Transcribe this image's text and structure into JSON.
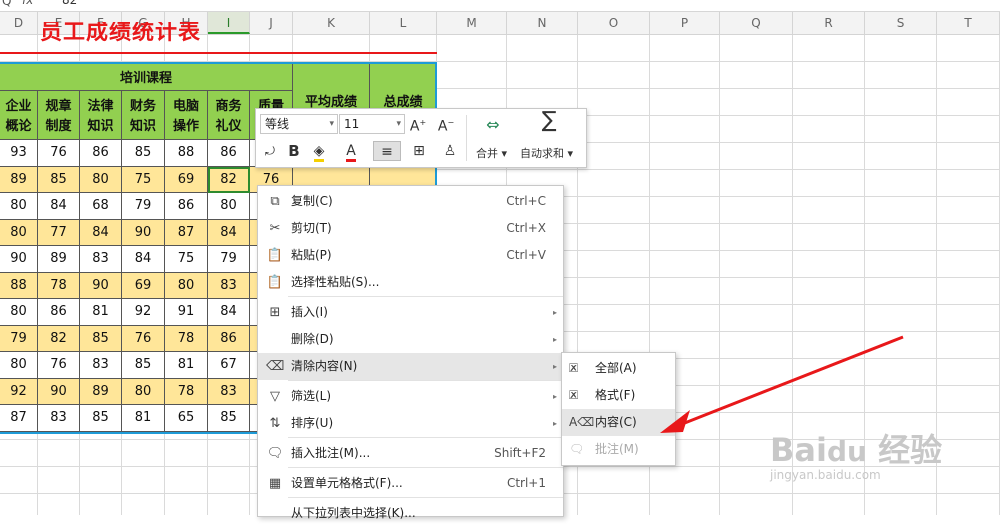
{
  "formula_bar": {
    "search_glyph": "Q",
    "fx_label": "fx",
    "value": "82"
  },
  "columns": [
    "D",
    "E",
    "F",
    "G",
    "H",
    "I",
    "J",
    "K",
    "L",
    "M",
    "N",
    "O",
    "P",
    "Q",
    "R",
    "S",
    "T"
  ],
  "title_fragment": "员工成绩统计表",
  "table": {
    "group_header": "培训课程",
    "avg_header": "平均成绩",
    "total_header": "总成绩",
    "course_headers": [
      "企业\n概论",
      "规章\n制度",
      "法律\n知识",
      "财务\n知识",
      "电脑\n操作",
      "商务\n礼仪",
      "质量"
    ],
    "rows": [
      [
        "93",
        "76",
        "86",
        "85",
        "88",
        "86",
        ""
      ],
      [
        "89",
        "85",
        "80",
        "75",
        "69",
        "82",
        "76"
      ],
      [
        "80",
        "84",
        "68",
        "79",
        "86",
        "80",
        ""
      ],
      [
        "80",
        "77",
        "84",
        "90",
        "87",
        "84",
        ""
      ],
      [
        "90",
        "89",
        "83",
        "84",
        "75",
        "79",
        ""
      ],
      [
        "88",
        "78",
        "90",
        "69",
        "80",
        "83",
        ""
      ],
      [
        "80",
        "86",
        "81",
        "92",
        "91",
        "84",
        ""
      ],
      [
        "79",
        "82",
        "85",
        "76",
        "78",
        "86",
        ""
      ],
      [
        "80",
        "76",
        "83",
        "85",
        "81",
        "67",
        ""
      ],
      [
        "92",
        "90",
        "89",
        "80",
        "78",
        "83",
        ""
      ],
      [
        "87",
        "83",
        "85",
        "81",
        "65",
        "85",
        ""
      ]
    ]
  },
  "toolbar": {
    "font_name": "等线",
    "font_size": "11",
    "merge_label": "合并",
    "autosum_label": "自动求和"
  },
  "context_menu": {
    "items": [
      {
        "label": "复制(C)",
        "shortcut": "Ctrl+C",
        "icon": "copy-icon",
        "glyph": "⧉"
      },
      {
        "label": "剪切(T)",
        "shortcut": "Ctrl+X",
        "icon": "scissors-icon",
        "glyph": "✂"
      },
      {
        "label": "粘贴(P)",
        "shortcut": "Ctrl+V",
        "icon": "paste-icon",
        "glyph": "📋"
      },
      {
        "label": "选择性粘贴(S)...",
        "shortcut": "",
        "icon": "paste-special-icon",
        "glyph": "📋"
      },
      {
        "label": "插入(I)",
        "shortcut": "",
        "icon": "insert-icon",
        "glyph": "⊞"
      },
      {
        "label": "删除(D)",
        "shortcut": "",
        "icon": "",
        "glyph": ""
      },
      {
        "label": "清除内容(N)",
        "shortcut": "",
        "icon": "eraser-icon",
        "glyph": "⌫"
      },
      {
        "label": "筛选(L)",
        "shortcut": "",
        "icon": "filter-icon",
        "glyph": "▽"
      },
      {
        "label": "排序(U)",
        "shortcut": "",
        "icon": "sort-icon",
        "glyph": "⇅"
      },
      {
        "label": "插入批注(M)...",
        "shortcut": "Shift+F2",
        "icon": "comment-icon",
        "glyph": "🗨"
      },
      {
        "label": "设置单元格格式(F)...",
        "shortcut": "Ctrl+1",
        "icon": "format-cells-icon",
        "glyph": "▦"
      },
      {
        "label": "从下拉列表中选择(K)...",
        "shortcut": "",
        "icon": "",
        "glyph": ""
      }
    ]
  },
  "submenu": {
    "items": [
      {
        "label": "全部(A)",
        "icon": "clear-all-icon"
      },
      {
        "label": "格式(F)",
        "icon": "clear-format-icon"
      },
      {
        "label": "内容(C)",
        "icon": "clear-content-icon"
      },
      {
        "label": "批注(M)",
        "icon": "clear-comment-icon"
      }
    ]
  },
  "watermark": {
    "main": "Bai du 经验",
    "sub": "jingyan.baidu.com"
  }
}
